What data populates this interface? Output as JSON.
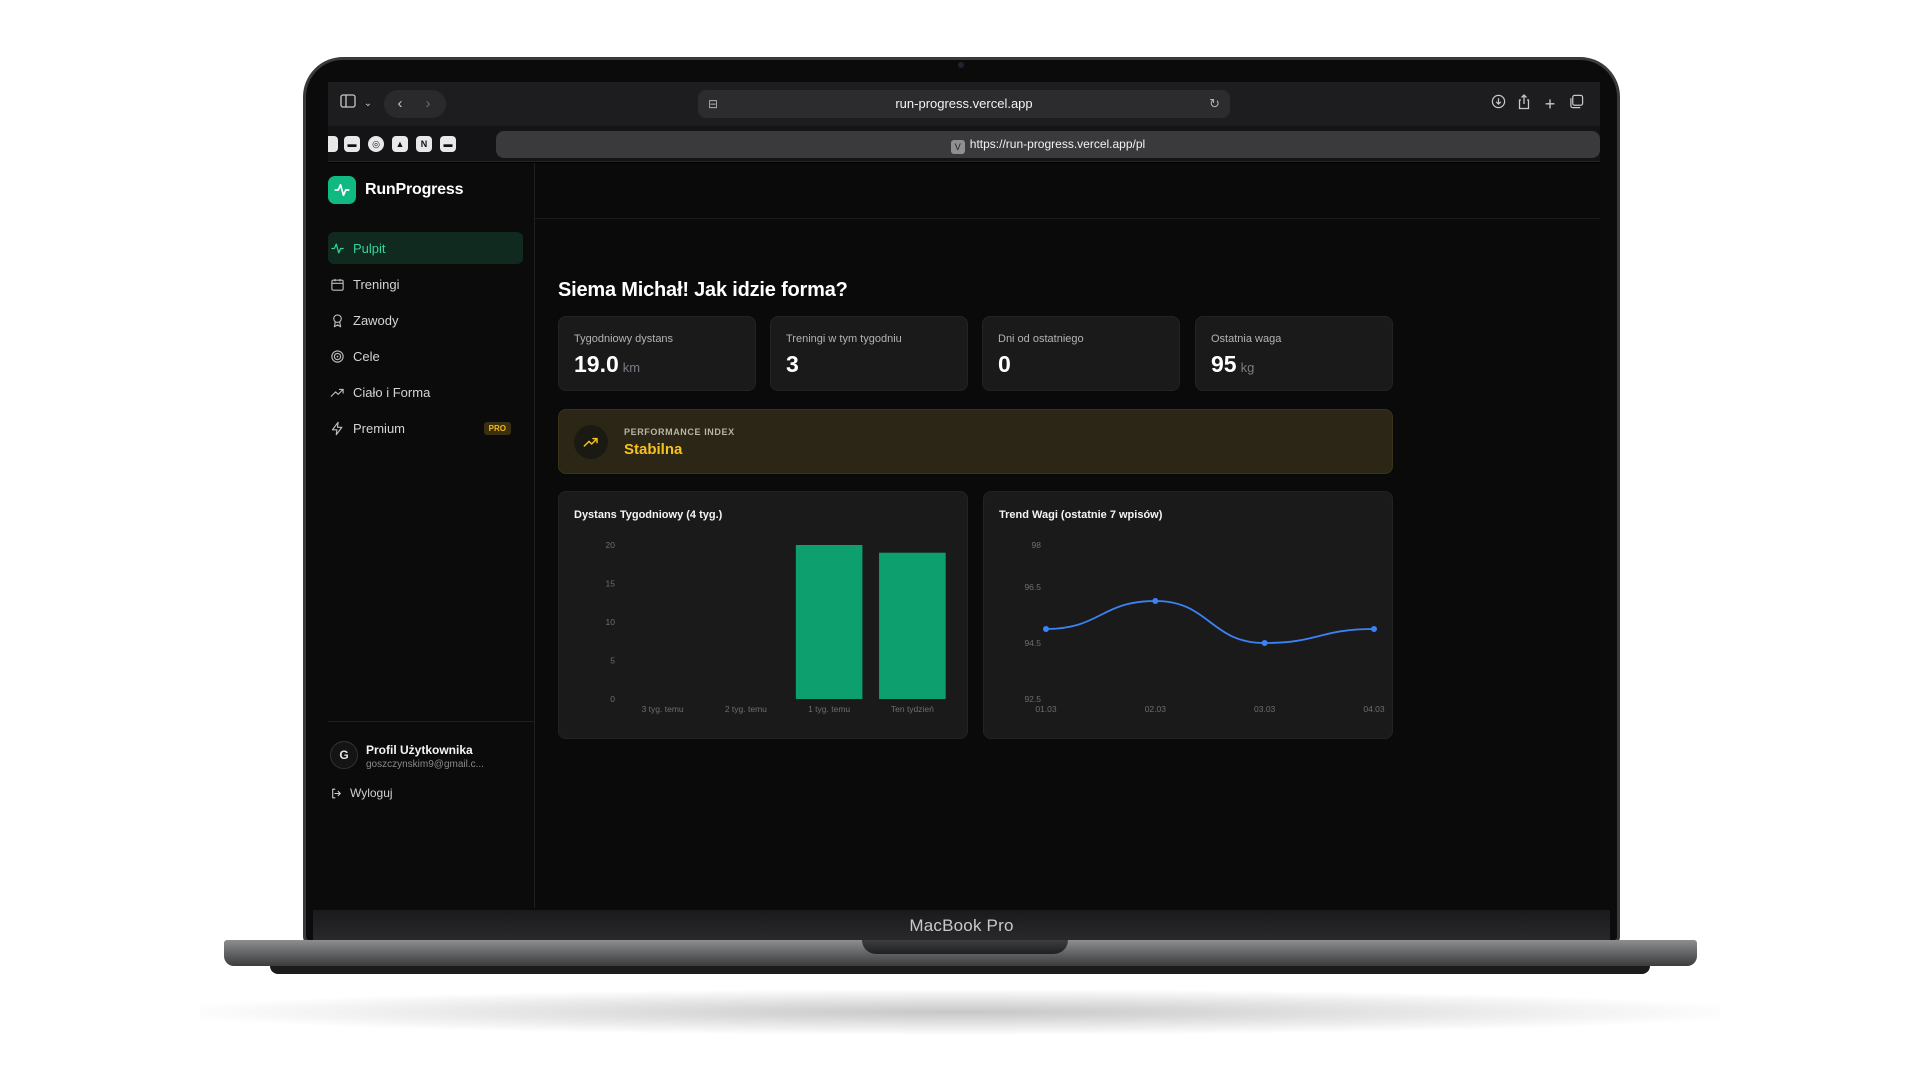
{
  "device": {
    "label": "MacBook Pro"
  },
  "browser": {
    "address": "run-progress.vercel.app",
    "tab_url": "https://run-progress.vercel.app/pl",
    "tab_badge": "V"
  },
  "app": {
    "brand": "RunProgress",
    "accent": "#10b981",
    "nav": [
      {
        "label": "Pulpit",
        "icon": "activity-icon",
        "active": true
      },
      {
        "label": "Treningi",
        "icon": "calendar-icon"
      },
      {
        "label": "Zawody",
        "icon": "award-icon"
      },
      {
        "label": "Cele",
        "icon": "target-icon"
      },
      {
        "label": "Ciało i Forma",
        "icon": "trending-up-icon"
      },
      {
        "label": "Premium",
        "icon": "lightning-icon",
        "badge": "PRO"
      }
    ],
    "profile": {
      "initial": "G",
      "name": "Profil Użytkownika",
      "email": "goszczynskim9@gmail.c..."
    },
    "logout": "Wyloguj"
  },
  "main": {
    "greeting": "Siema Michał! Jak idzie forma?",
    "stats": [
      {
        "label": "Tygodniowy dystans",
        "value": "19.0",
        "unit": "km"
      },
      {
        "label": "Treningi w tym tygodniu",
        "value": "3",
        "unit": ""
      },
      {
        "label": "Dni od ostatniego",
        "value": "0",
        "unit": ""
      },
      {
        "label": "Ostatnia waga",
        "value": "95",
        "unit": "kg"
      }
    ],
    "performance": {
      "label": "PERFORMANCE INDEX",
      "value": "Stabilna",
      "color": "#f6c21c"
    }
  },
  "chart_data": [
    {
      "type": "bar",
      "title": "Dystans Tygodniowy (4 tyg.)",
      "categories": [
        "3 tyg. temu",
        "2 tyg. temu",
        "1 tyg. temu",
        "Ten tydzień"
      ],
      "values": [
        0,
        0,
        20,
        19
      ],
      "ylim": [
        0,
        20
      ],
      "yticks": [
        "0",
        "5",
        "10",
        "15",
        "20"
      ],
      "grid": false,
      "color": "#0e9f6e"
    },
    {
      "type": "line",
      "title": "Trend Wagi (ostatnie 7 wpisów)",
      "x": [
        "01.03",
        "02.03",
        "03.03",
        "04.03"
      ],
      "values": [
        95.0,
        96.0,
        94.5,
        95.0
      ],
      "ylim": [
        92.5,
        98
      ],
      "yticks": [
        "92.5",
        "94.5",
        "96.5",
        "98"
      ],
      "grid": false,
      "color": "#3b82f6"
    }
  ]
}
